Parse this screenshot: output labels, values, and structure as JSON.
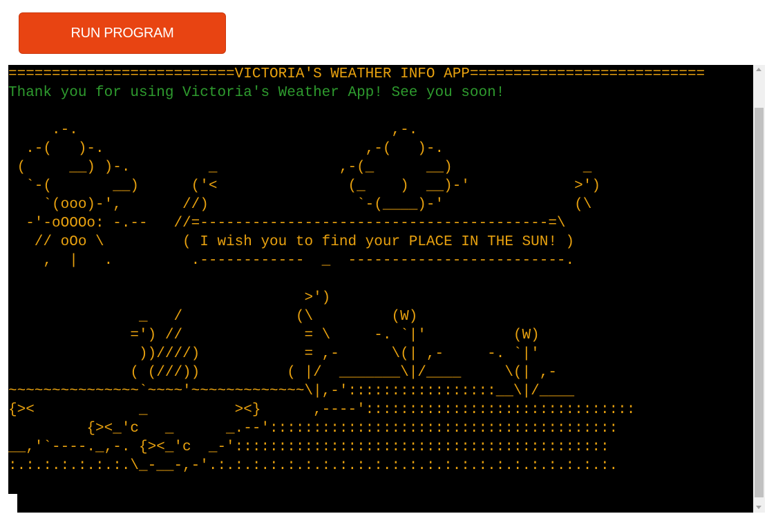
{
  "run_button": {
    "label": "RUN PROGRAM"
  },
  "terminal": {
    "text_color": "#e8a10f",
    "message_color": "#2e9b2e",
    "lines": [
      "==========================VICTORIA'S WEATHER INFO APP===========================",
      "Thank you for using Victoria's Weather App! See you soon!",
      "",
      "     .-.                                    ,-.",
      "  .-(   )-.                              ,-(   )-.",
      " (     __) )-.         _              ,-(_      __)               _",
      "  `-(       __)      ('<               (_    )  __)-'            >')",
      "    `(ooo)-',       //)                 `-(____)-'               (\\",
      "  -'-oOOOo: -.--   //=----------------------------------------=\\",
      "   // oOo \\         ( I wish you to find your PLACE IN THE SUN! )",
      "    ,  |   .         .------------  _  -------------------------.",
      "",
      "                                  >')",
      "               _   /             (\\         (W)",
      "              =') //              = \\     -. `|'          (W)",
      "               ))////)            = ,-      \\(| ,-     -. `|'",
      "              ( (///))          ( |/  _______\\|/____     \\(| ,-",
      "~~~~~~~~~~~~~~~`~~~~'~~~~~~~~~~~~~\\|,-':::::::::::::::::__\\|/____",
      "{><            _          ><}      ,----':::::::::::::::::::::::::::::::",
      "         {><_'c   _      _.--'::::::::::::::::::::::::::::::::::::::::",
      "__,'`----._,-. {><_'c  _-':::::::::::::::::::::::::::::::::::::::::::",
      ":.:.:.:.:.:.:.\\_-__-,-'.:.:.:.:.:.:.:.:.:.:.:.:.:.:.:.:.:.:.:.:.:.:.:."
    ]
  }
}
